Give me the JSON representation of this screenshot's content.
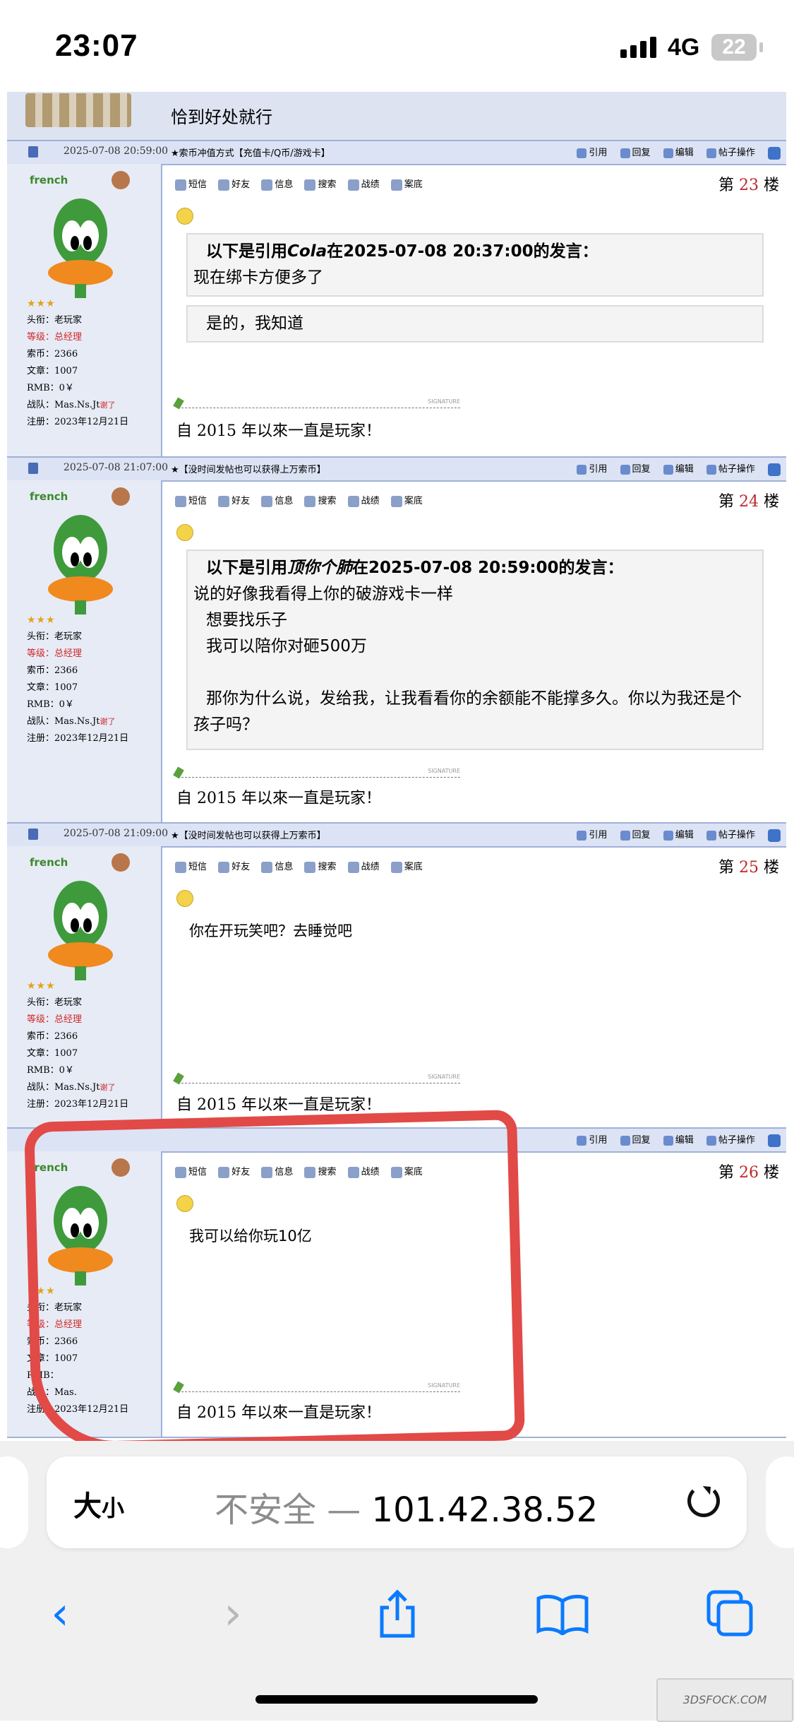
{
  "status_bar": {
    "time": "23:07",
    "network": "4G",
    "battery": "22"
  },
  "top_partial": {
    "text": "恰到好处就行"
  },
  "posts": [
    {
      "header": {
        "date": "2025-07-08 20:59:00",
        "ad": "★索币冲值方式【充值卡/Q币/游戏卡】",
        "actions": [
          "引用",
          "回复",
          "编辑",
          "帖子操作"
        ]
      },
      "user": {
        "name": "french",
        "title": "头衔：老玩家",
        "level": "等级：总经理",
        "coins": "索币：2366",
        "posts": "文章：1007",
        "rmb": "RMB：0￥",
        "team": "战队：Mas.Ns.Jt",
        "team_sign": "谢了",
        "reg": "注册：2023年12月21日"
      },
      "toolbar": [
        "短信",
        "好友",
        "信息",
        "搜索",
        "战绩",
        "案底"
      ],
      "floor": {
        "prefix": "第",
        "num": "23",
        "suffix": "楼"
      },
      "quote_head": {
        "pre": "以下是引用",
        "author": "Cola",
        "post": "在2025-07-08 20:37:00的发言："
      },
      "quote_lines": [
        "现在绑卡方便多了"
      ],
      "reply_lines": [
        "是的，我知道"
      ],
      "body": "",
      "signature": "自 2015 年以來一直是玩家！",
      "sig_caption": "SIGNATURE"
    },
    {
      "header": {
        "date": "2025-07-08 21:07:00",
        "ad": "★【没时间发帖也可以获得上万索币】",
        "actions": [
          "引用",
          "回复",
          "编辑",
          "帖子操作"
        ]
      },
      "user": {
        "name": "french",
        "title": "头衔：老玩家",
        "level": "等级：总经理",
        "coins": "索币：2366",
        "posts": "文章：1007",
        "rmb": "RMB：0￥",
        "team": "战队：Mas.Ns.Jt",
        "team_sign": "谢了",
        "reg": "注册：2023年12月21日"
      },
      "toolbar": [
        "短信",
        "好友",
        "信息",
        "搜索",
        "战绩",
        "案底"
      ],
      "floor": {
        "prefix": "第",
        "num": "24",
        "suffix": "楼"
      },
      "quote_head": {
        "pre": "以下是引用",
        "author": "顶你个肺",
        "post": "在2025-07-08 20:59:00的发言："
      },
      "quote_lines": [
        "说的好像我看得上你的破游戏卡一样",
        "想要找乐子",
        "我可以陪你对砸500万"
      ],
      "reply_lines": [
        "那你为什么说，发给我，让我看看你的余额能不能撑多久。你以为我还是个孩子吗？"
      ],
      "body": "",
      "signature": "自 2015 年以來一直是玩家！",
      "sig_caption": "SIGNATURE"
    },
    {
      "header": {
        "date": "2025-07-08 21:09:00",
        "ad": "★【没时间发帖也可以获得上万索币】",
        "actions": [
          "引用",
          "回复",
          "编辑",
          "帖子操作"
        ]
      },
      "user": {
        "name": "french",
        "title": "头衔：老玩家",
        "level": "等级：总经理",
        "coins": "索币：2366",
        "posts": "文章：1007",
        "rmb": "RMB：0￥",
        "team": "战队：Mas.Ns.Jt",
        "team_sign": "谢了",
        "reg": "注册：2023年12月21日"
      },
      "toolbar": [
        "短信",
        "好友",
        "信息",
        "搜索",
        "战绩",
        "案底"
      ],
      "floor": {
        "prefix": "第",
        "num": "25",
        "suffix": "楼"
      },
      "body": "你在开玩笑吧？去睡觉吧",
      "signature": "自 2015 年以來一直是玩家！",
      "sig_caption": "SIGNATURE"
    },
    {
      "header": {
        "date": "",
        "ad": "",
        "actions": [
          "引用",
          "回复",
          "编辑",
          "帖子操作"
        ]
      },
      "user": {
        "name": "french",
        "title": "头衔：老玩家",
        "level": "等级：总经理",
        "coins": "索币：2366",
        "posts": "文章：1007",
        "rmb": "RMB：",
        "team": "战队：Mas.",
        "team_sign": "",
        "reg": "注册：2023年12月21日"
      },
      "toolbar": [
        "短信",
        "好友",
        "信息",
        "搜索",
        "战绩",
        "案底"
      ],
      "floor": {
        "prefix": "第",
        "num": "26",
        "suffix": "楼"
      },
      "body": "我可以给你玩10亿",
      "signature": "自 2015 年以來一直是玩家！",
      "sig_caption": "SIGNATURE"
    }
  ],
  "browser": {
    "size_label": "大",
    "size_small": "小",
    "insecure": "不安全",
    "dash": " — ",
    "host": "101.42.38.52"
  },
  "nav": {
    "back": "‹",
    "forward": "›"
  },
  "watermark": "3DSFOCK.COM",
  "colors": {
    "highlight_circle": "#e14a47",
    "floor_number": "#c0262a",
    "accent": "#0a7aff"
  }
}
